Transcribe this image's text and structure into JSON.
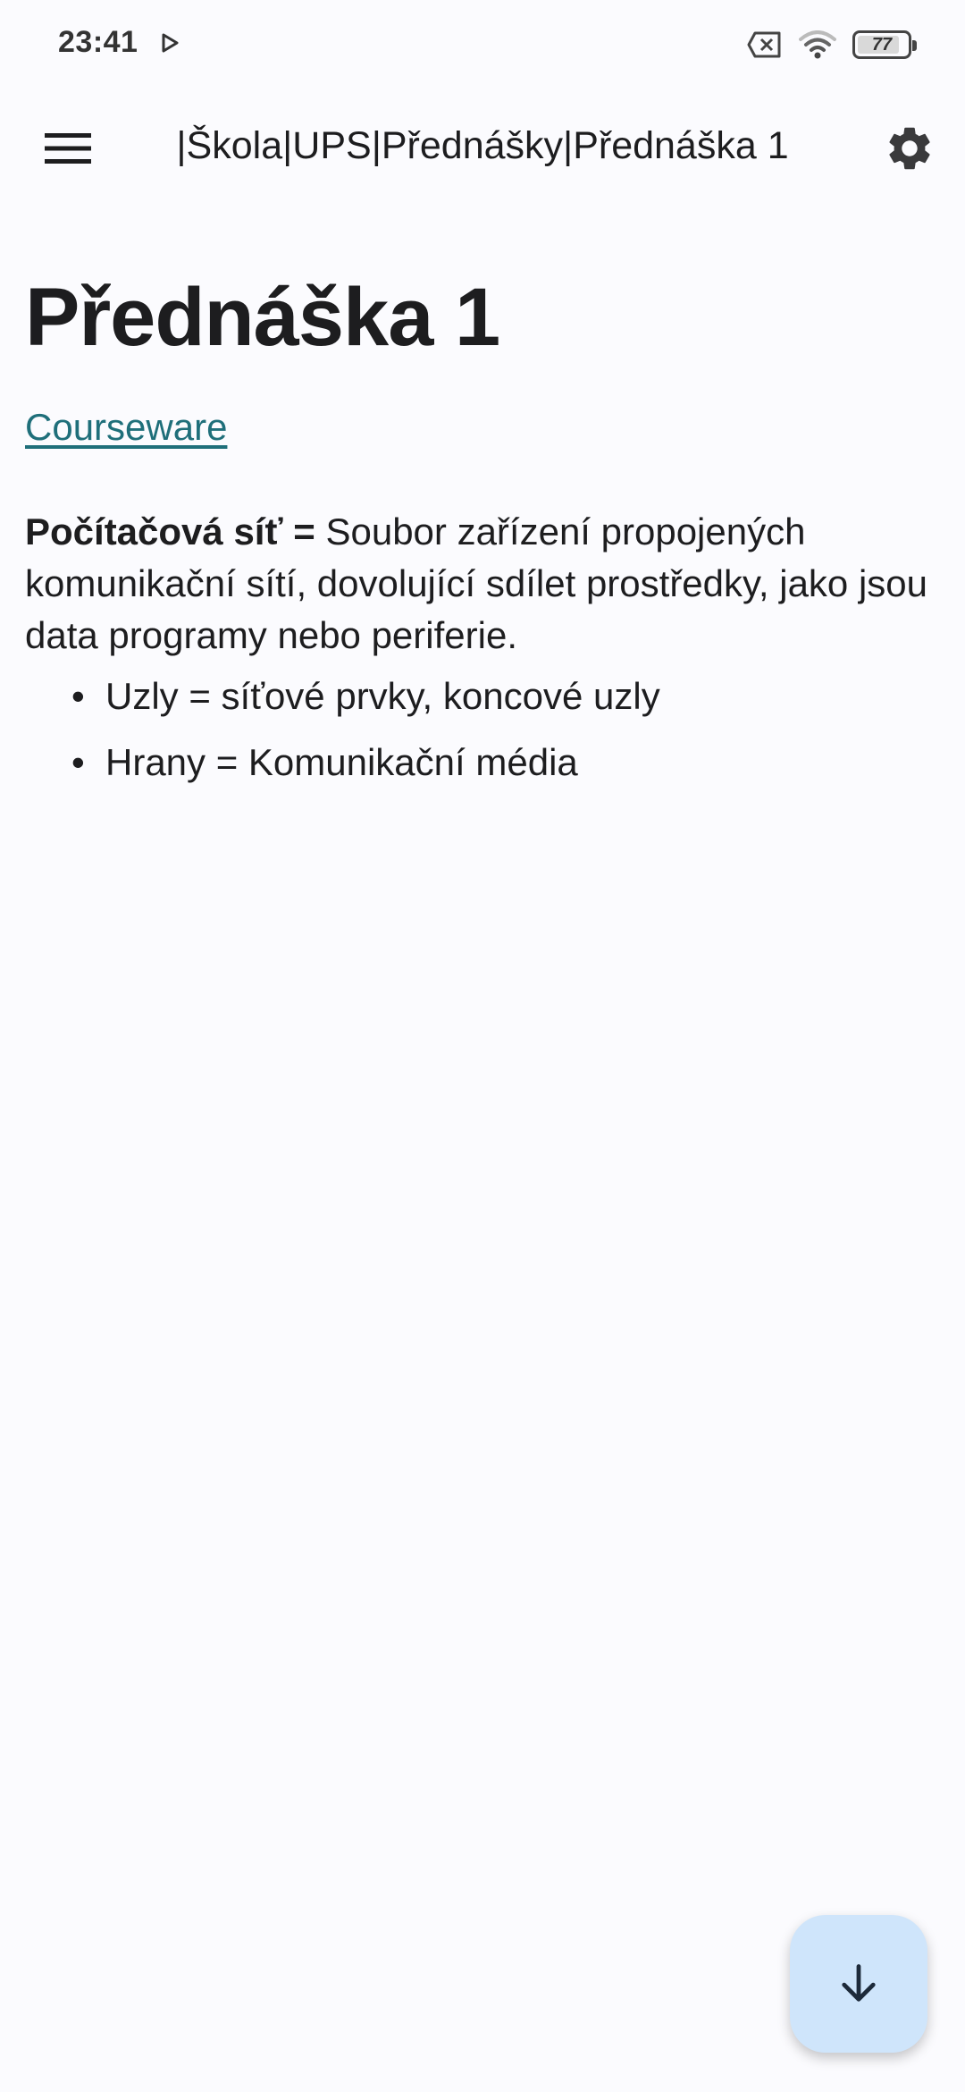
{
  "status_bar": {
    "time": "23:41",
    "battery_level": "77",
    "icons": [
      "play-icon",
      "sim-off-icon",
      "wifi-icon",
      "battery-icon"
    ]
  },
  "app_bar": {
    "title": "|Škola|UPS|Přednášky|Přednáška 1",
    "menu_icon": "hamburger-menu-icon",
    "settings_icon": "gear-icon"
  },
  "page": {
    "title": "Přednáška 1",
    "link_label": "Courseware",
    "definition": {
      "term": "Počítačová síť =",
      "text": " Soubor zařízení propojených komunikační sítí, dovolující sdílet prostředky, jako jsou data programy nebo periferie."
    },
    "bullets": [
      "Uzly = síťové prvky, koncové uzly",
      "Hrany = Komunikační média"
    ]
  },
  "fab": {
    "icon": "arrow-down-icon"
  },
  "colors": {
    "background": "#fbfbfe",
    "link": "#1f6f7a",
    "fab": "#cfe5fb"
  }
}
